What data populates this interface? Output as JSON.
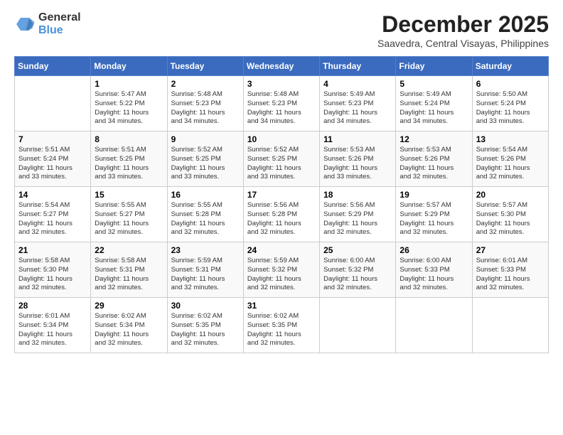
{
  "header": {
    "logo_general": "General",
    "logo_blue": "Blue",
    "month_title": "December 2025",
    "location": "Saavedra, Central Visayas, Philippines"
  },
  "days_of_week": [
    "Sunday",
    "Monday",
    "Tuesday",
    "Wednesday",
    "Thursday",
    "Friday",
    "Saturday"
  ],
  "weeks": [
    [
      {
        "day": "",
        "info": ""
      },
      {
        "day": "1",
        "info": "Sunrise: 5:47 AM\nSunset: 5:22 PM\nDaylight: 11 hours\nand 34 minutes."
      },
      {
        "day": "2",
        "info": "Sunrise: 5:48 AM\nSunset: 5:23 PM\nDaylight: 11 hours\nand 34 minutes."
      },
      {
        "day": "3",
        "info": "Sunrise: 5:48 AM\nSunset: 5:23 PM\nDaylight: 11 hours\nand 34 minutes."
      },
      {
        "day": "4",
        "info": "Sunrise: 5:49 AM\nSunset: 5:23 PM\nDaylight: 11 hours\nand 34 minutes."
      },
      {
        "day": "5",
        "info": "Sunrise: 5:49 AM\nSunset: 5:24 PM\nDaylight: 11 hours\nand 34 minutes."
      },
      {
        "day": "6",
        "info": "Sunrise: 5:50 AM\nSunset: 5:24 PM\nDaylight: 11 hours\nand 33 minutes."
      }
    ],
    [
      {
        "day": "7",
        "info": "Sunrise: 5:51 AM\nSunset: 5:24 PM\nDaylight: 11 hours\nand 33 minutes."
      },
      {
        "day": "8",
        "info": "Sunrise: 5:51 AM\nSunset: 5:25 PM\nDaylight: 11 hours\nand 33 minutes."
      },
      {
        "day": "9",
        "info": "Sunrise: 5:52 AM\nSunset: 5:25 PM\nDaylight: 11 hours\nand 33 minutes."
      },
      {
        "day": "10",
        "info": "Sunrise: 5:52 AM\nSunset: 5:25 PM\nDaylight: 11 hours\nand 33 minutes."
      },
      {
        "day": "11",
        "info": "Sunrise: 5:53 AM\nSunset: 5:26 PM\nDaylight: 11 hours\nand 33 minutes."
      },
      {
        "day": "12",
        "info": "Sunrise: 5:53 AM\nSunset: 5:26 PM\nDaylight: 11 hours\nand 32 minutes."
      },
      {
        "day": "13",
        "info": "Sunrise: 5:54 AM\nSunset: 5:26 PM\nDaylight: 11 hours\nand 32 minutes."
      }
    ],
    [
      {
        "day": "14",
        "info": "Sunrise: 5:54 AM\nSunset: 5:27 PM\nDaylight: 11 hours\nand 32 minutes."
      },
      {
        "day": "15",
        "info": "Sunrise: 5:55 AM\nSunset: 5:27 PM\nDaylight: 11 hours\nand 32 minutes."
      },
      {
        "day": "16",
        "info": "Sunrise: 5:55 AM\nSunset: 5:28 PM\nDaylight: 11 hours\nand 32 minutes."
      },
      {
        "day": "17",
        "info": "Sunrise: 5:56 AM\nSunset: 5:28 PM\nDaylight: 11 hours\nand 32 minutes."
      },
      {
        "day": "18",
        "info": "Sunrise: 5:56 AM\nSunset: 5:29 PM\nDaylight: 11 hours\nand 32 minutes."
      },
      {
        "day": "19",
        "info": "Sunrise: 5:57 AM\nSunset: 5:29 PM\nDaylight: 11 hours\nand 32 minutes."
      },
      {
        "day": "20",
        "info": "Sunrise: 5:57 AM\nSunset: 5:30 PM\nDaylight: 11 hours\nand 32 minutes."
      }
    ],
    [
      {
        "day": "21",
        "info": "Sunrise: 5:58 AM\nSunset: 5:30 PM\nDaylight: 11 hours\nand 32 minutes."
      },
      {
        "day": "22",
        "info": "Sunrise: 5:58 AM\nSunset: 5:31 PM\nDaylight: 11 hours\nand 32 minutes."
      },
      {
        "day": "23",
        "info": "Sunrise: 5:59 AM\nSunset: 5:31 PM\nDaylight: 11 hours\nand 32 minutes."
      },
      {
        "day": "24",
        "info": "Sunrise: 5:59 AM\nSunset: 5:32 PM\nDaylight: 11 hours\nand 32 minutes."
      },
      {
        "day": "25",
        "info": "Sunrise: 6:00 AM\nSunset: 5:32 PM\nDaylight: 11 hours\nand 32 minutes."
      },
      {
        "day": "26",
        "info": "Sunrise: 6:00 AM\nSunset: 5:33 PM\nDaylight: 11 hours\nand 32 minutes."
      },
      {
        "day": "27",
        "info": "Sunrise: 6:01 AM\nSunset: 5:33 PM\nDaylight: 11 hours\nand 32 minutes."
      }
    ],
    [
      {
        "day": "28",
        "info": "Sunrise: 6:01 AM\nSunset: 5:34 PM\nDaylight: 11 hours\nand 32 minutes."
      },
      {
        "day": "29",
        "info": "Sunrise: 6:02 AM\nSunset: 5:34 PM\nDaylight: 11 hours\nand 32 minutes."
      },
      {
        "day": "30",
        "info": "Sunrise: 6:02 AM\nSunset: 5:35 PM\nDaylight: 11 hours\nand 32 minutes."
      },
      {
        "day": "31",
        "info": "Sunrise: 6:02 AM\nSunset: 5:35 PM\nDaylight: 11 hours\nand 32 minutes."
      },
      {
        "day": "",
        "info": ""
      },
      {
        "day": "",
        "info": ""
      },
      {
        "day": "",
        "info": ""
      }
    ]
  ]
}
